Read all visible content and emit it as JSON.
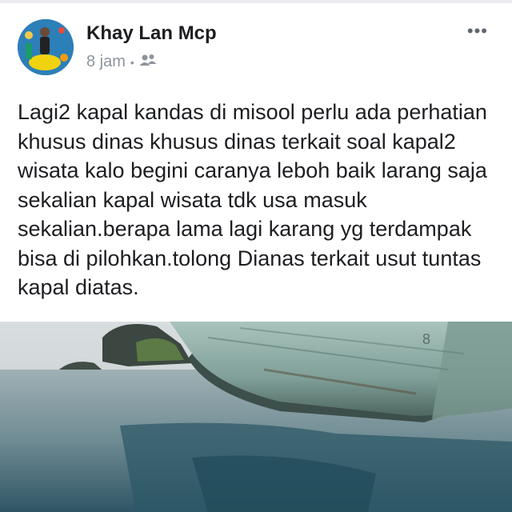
{
  "post": {
    "author": "Khay Lan Mcp",
    "time": "8 jam",
    "separator": "•",
    "audience_icon": "friends-icon",
    "more_icon": "more-options-icon",
    "more_label": "•••",
    "text": "Lagi2 kapal kandas di misool perlu ada perhatian khusus dinas khusus dinas terkait soal kapal2 wisata kalo begini caranya leboh baik larang saja sekalian kapal wisata tdk usa masuk sekalian.berapa lama lagi karang yg terdampak bisa di pilohkan.tolong Dianas terkait usut tuntas kapal diatas.",
    "image_number": "8"
  },
  "colors": {
    "text": "#1c1e21",
    "meta": "#8d949e",
    "hull": "#8fb3ad",
    "water": "#3f6b7c"
  }
}
